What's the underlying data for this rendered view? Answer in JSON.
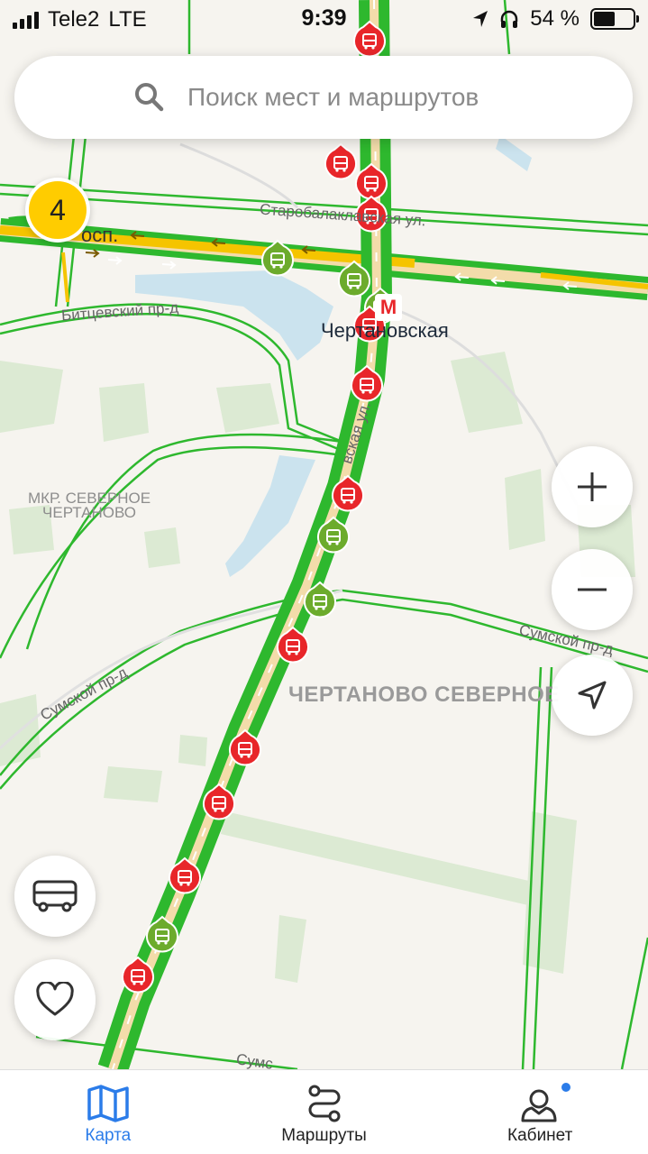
{
  "status_bar": {
    "carrier": "Tele2",
    "network": "LTE",
    "time": "9:39",
    "battery_percent": "54 %",
    "battery_level": 0.54
  },
  "search": {
    "placeholder": "Поиск мест и маршрутов",
    "icon": "search-icon"
  },
  "traffic": {
    "level": "4",
    "color": "#ffcc00"
  },
  "map": {
    "streets": [
      "Старобалаклавская ул.",
      "Битцевский пр-д",
      "Сумской пр-д",
      "Сумской пр-д",
      "осп.",
      "Сумс",
      "вская ул."
    ],
    "districts": [
      "ЧЕРТАНОВО СЕВЕРНОЕ"
    ],
    "microdistricts": [
      "МКР. СЕВЕРНОЕ ЧЕРТАНОВО"
    ],
    "metro_station": "Чертановская",
    "metro_symbol": "М",
    "colors": {
      "road_green": "#2eb82e",
      "road_yellow": "#f5c400",
      "stop_red": "#e8262a",
      "stop_green": "#6cab2c",
      "water": "#cbe3ee",
      "park": "#dcead3",
      "background": "#f6f4ef"
    }
  },
  "controls": {
    "zoom_in": "plus-icon",
    "zoom_out": "minus-icon",
    "locate": "location-arrow-icon",
    "transport": "bus-icon",
    "favorites": "heart-icon"
  },
  "tabbar": {
    "tabs": [
      {
        "label": "Карта",
        "icon": "map-icon",
        "active": true
      },
      {
        "label": "Маршруты",
        "icon": "route-icon",
        "active": false
      },
      {
        "label": "Кабинет",
        "icon": "profile-icon",
        "active": false
      }
    ],
    "accent": "#2b7ce9"
  }
}
